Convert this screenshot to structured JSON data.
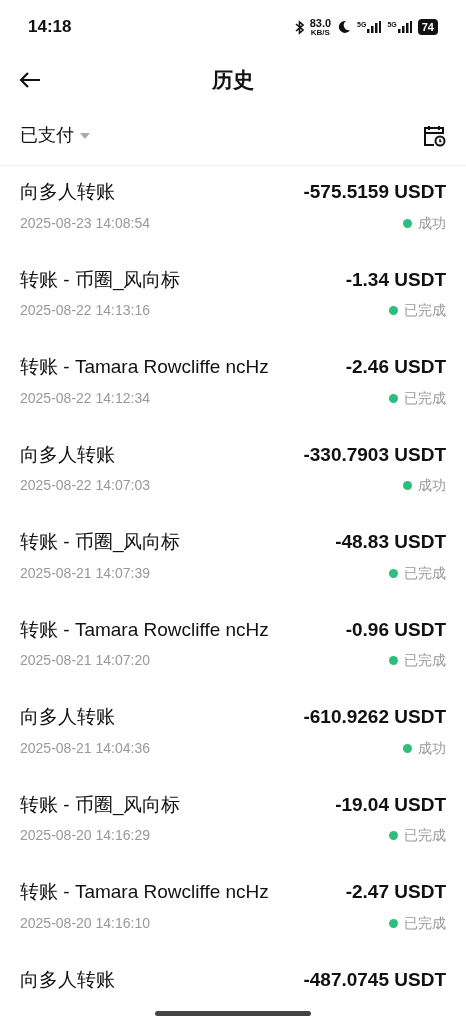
{
  "status_bar": {
    "time": "14:18",
    "speed": "83.0",
    "speed_unit": "KB/S",
    "sim_1": "5G",
    "sim_2": "5G",
    "battery": "74"
  },
  "header": {
    "title": "历史"
  },
  "filter": {
    "label": "已支付"
  },
  "transactions": [
    {
      "title": "向多人转账",
      "amount": "-575.5159 USDT",
      "time": "2025-08-23 14:08:54",
      "status": "成功"
    },
    {
      "title": "转账 - 币圈_风向标",
      "amount": "-1.34 USDT",
      "time": "2025-08-22 14:13:16",
      "status": "已完成"
    },
    {
      "title": "转账 - Tamara Rowcliffe ncHz",
      "amount": "-2.46 USDT",
      "time": "2025-08-22 14:12:34",
      "status": "已完成"
    },
    {
      "title": "向多人转账",
      "amount": "-330.7903 USDT",
      "time": "2025-08-22 14:07:03",
      "status": "成功"
    },
    {
      "title": "转账 - 币圈_风向标",
      "amount": "-48.83 USDT",
      "time": "2025-08-21 14:07:39",
      "status": "已完成"
    },
    {
      "title": "转账 - Tamara Rowcliffe ncHz",
      "amount": "-0.96 USDT",
      "time": "2025-08-21 14:07:20",
      "status": "已完成"
    },
    {
      "title": "向多人转账",
      "amount": "-610.9262 USDT",
      "time": "2025-08-21 14:04:36",
      "status": "成功"
    },
    {
      "title": "转账 - 币圈_风向标",
      "amount": "-19.04 USDT",
      "time": "2025-08-20 14:16:29",
      "status": "已完成"
    },
    {
      "title": "转账 - Tamara Rowcliffe ncHz",
      "amount": "-2.47 USDT",
      "time": "2025-08-20 14:16:10",
      "status": "已完成"
    },
    {
      "title": "向多人转账",
      "amount": "-487.0745 USDT"
    }
  ]
}
